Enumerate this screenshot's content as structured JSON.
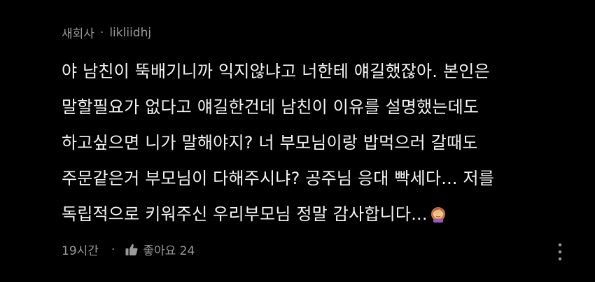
{
  "comment": {
    "author_meta": {
      "name": "새회사",
      "separator": "·",
      "handle": "likliidhj"
    },
    "body_lines": [
      "야 남친이 뚝배기니까 익지않냐고 너한테 얘길했잖아. 본인은",
      "말할필요가 없다고 얘길한건데 남친이 이유를 설명했는데도",
      "하고싶으면 니가 말해야지? 너 부모님이랑 밥먹으러 갈때도",
      "주문같은거 부모님이 다해주시냐? 공주님 응대 빡세다... 저를",
      "독립적으로 키워주신 우리부모님 정말 감사합니다..."
    ],
    "emoji": "woman-facepalming-icon",
    "footer": {
      "time": "19시간",
      "separator": "·",
      "like_icon": "thumbs-up-icon",
      "like_label": "좋아요 24",
      "more_icon": "more-vertical-icon"
    }
  },
  "colors": {
    "background": "#000000",
    "text": "#f4f4f4",
    "meta": "#9a9a9a"
  }
}
